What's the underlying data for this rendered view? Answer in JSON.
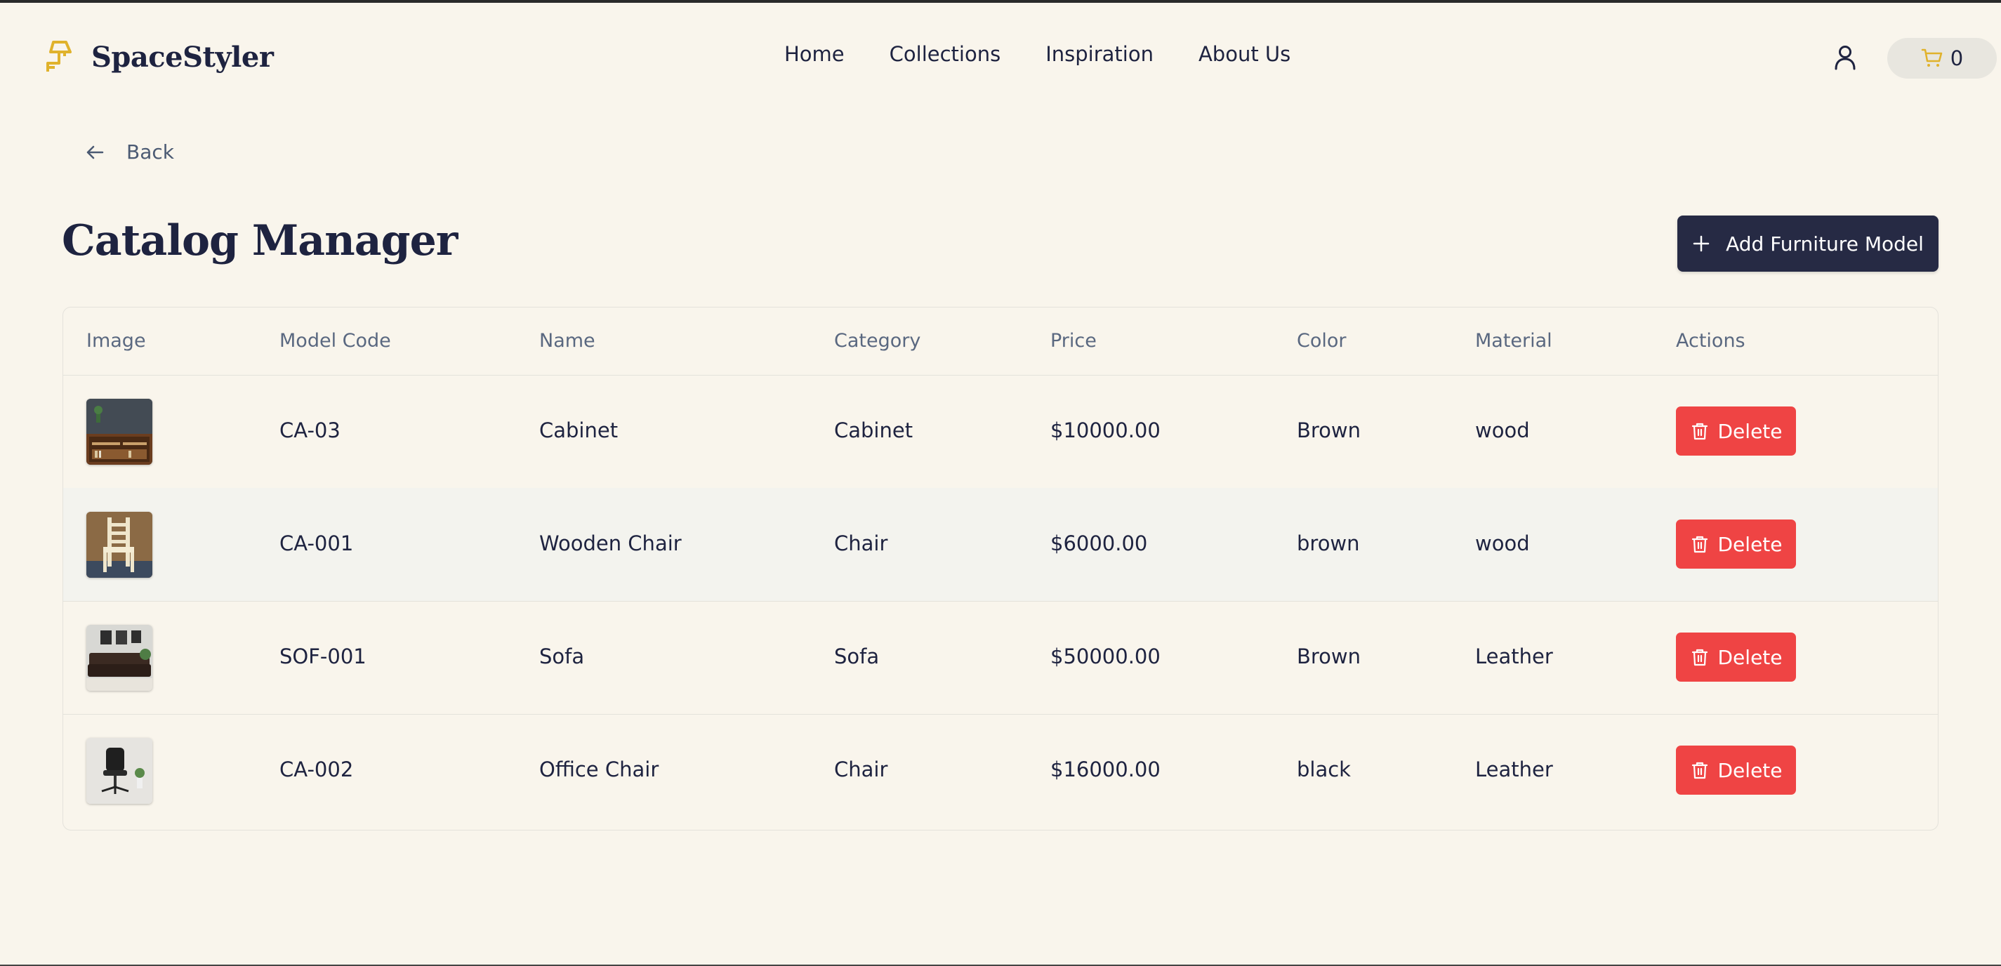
{
  "brand": {
    "name": "SpaceStyler",
    "accent": "#e0b22c"
  },
  "nav": [
    {
      "label": "Home"
    },
    {
      "label": "Collections"
    },
    {
      "label": "Inspiration"
    },
    {
      "label": "About Us"
    }
  ],
  "cart": {
    "count": "0"
  },
  "back": {
    "label": "Back"
  },
  "page": {
    "title": "Catalog Manager",
    "add_button": "Add Furniture Model"
  },
  "table": {
    "columns": [
      "Image",
      "Model Code",
      "Name",
      "Category",
      "Price",
      "Color",
      "Material",
      "Actions"
    ],
    "rows": [
      {
        "image": "cabinet-thumbnail",
        "code": "CA-03",
        "name": "Cabinet",
        "category": "Cabinet",
        "price": "$10000.00",
        "color": "Brown",
        "material": "wood",
        "action": "Delete"
      },
      {
        "image": "wooden-chair-thumbnail",
        "code": "CA-001",
        "name": "Wooden Chair",
        "category": "Chair",
        "price": "$6000.00",
        "color": "brown",
        "material": "wood",
        "action": "Delete"
      },
      {
        "image": "sofa-thumbnail",
        "code": "SOF-001",
        "name": "Sofa",
        "category": "Sofa",
        "price": "$50000.00",
        "color": "Brown",
        "material": "Leather",
        "action": "Delete"
      },
      {
        "image": "office-chair-thumbnail",
        "code": "CA-002",
        "name": "Office Chair",
        "category": "Chair",
        "price": "$16000.00",
        "color": "black",
        "material": "Leather",
        "action": "Delete"
      }
    ]
  },
  "colors": {
    "background": "#f9f5ec",
    "primary": "#262a44",
    "danger": "#ef4444"
  }
}
